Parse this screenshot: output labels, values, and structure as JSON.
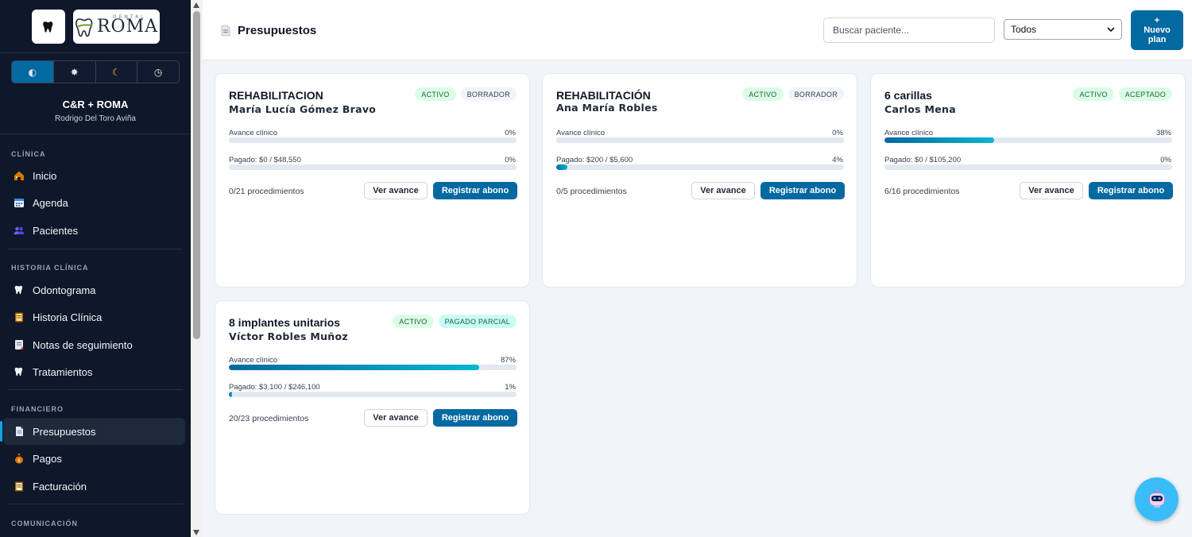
{
  "sidebar": {
    "clinic_name": "C&R + ROMA",
    "user_name": "Rodrigo Del Toro Aviña",
    "logo_text": "ROMA",
    "logo_small": "DENTAL",
    "sections": {
      "clinica": "CLÍNICA",
      "historia": "HISTORIA CLÍNICA",
      "financiero": "FINANCIERO",
      "comunicacion": "COMUNICACIÓN"
    },
    "items": {
      "inicio": "Inicio",
      "agenda": "Agenda",
      "pacientes": "Pacientes",
      "odontograma": "Odontograma",
      "historia_clinica": "Historia Clínica",
      "notas": "Notas de seguimiento",
      "tratamientos": "Tratamientos",
      "presupuestos": "Presupuestos",
      "pagos": "Pagos",
      "facturacion": "Facturación"
    },
    "theme_icons": [
      "contrast-icon",
      "sun-icon",
      "moon-icon",
      "clock-icon"
    ]
  },
  "header": {
    "title": "Presupuestos",
    "search_placeholder": "Buscar paciente...",
    "filter_selected": "Todos",
    "new_plus": "+",
    "new_line1": "Nuevo",
    "new_line2": "plan"
  },
  "labels": {
    "avance": "Avance clínico",
    "ver_avance": "Ver avance",
    "registrar_abono": "Registrar abono"
  },
  "cards": [
    {
      "title": "REHABILITACION",
      "patient": "María Lucía Gómez Bravo",
      "badges": [
        "ACTIVO",
        "BORRADOR"
      ],
      "avance_pct": "0%",
      "avance_value": 0,
      "pagado": "Pagado: $0 / $48,550",
      "pagado_pct": "0%",
      "pagado_value": 0,
      "procedimientos": "0/21 procedimientos"
    },
    {
      "title": "REHABILITACIÓN",
      "patient": "Ana María Robles",
      "badges": [
        "ACTIVO",
        "BORRADOR"
      ],
      "avance_pct": "0%",
      "avance_value": 0,
      "pagado": "Pagado: $200 / $5,600",
      "pagado_pct": "4%",
      "pagado_value": 4,
      "procedimientos": "0/5 procedimientos"
    },
    {
      "title": "6 carillas",
      "patient": "Carlos Mena",
      "badges": [
        "ACTIVO",
        "ACEPTADO"
      ],
      "avance_pct": "38%",
      "avance_value": 38,
      "pagado": "Pagado: $0 / $105,200",
      "pagado_pct": "0%",
      "pagado_value": 0,
      "procedimientos": "6/16 procedimientos"
    },
    {
      "title": "8 implantes unitarios",
      "patient": "Víctor Robles Muñoz",
      "badges": [
        "ACTIVO",
        "PAGADO PARCIAL"
      ],
      "avance_pct": "87%",
      "avance_value": 87,
      "pagado": "Pagado: $3,100 / $246,100",
      "pagado_pct": "1%",
      "pagado_value": 1,
      "procedimientos": "20/23 procedimientos"
    }
  ],
  "colors": {
    "sidebar_bg": "#0f172a",
    "primary": "#0369a1",
    "accent": "#06b6d4"
  }
}
